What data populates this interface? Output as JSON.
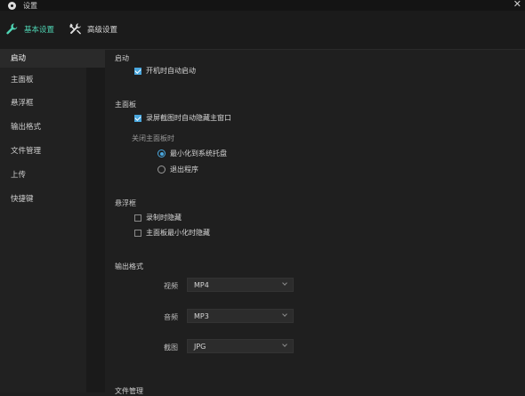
{
  "window": {
    "title": "设置",
    "close_glyph": "✕"
  },
  "tabs": [
    {
      "label": "基本设置",
      "icon": "wrench-icon",
      "active": true
    },
    {
      "label": "高级设置",
      "icon": "tools-icon",
      "active": false
    }
  ],
  "sidebar": {
    "items": [
      {
        "label": "启动",
        "active": true
      },
      {
        "label": "主面板",
        "active": false
      },
      {
        "label": "悬浮框",
        "active": false
      },
      {
        "label": "输出格式",
        "active": false
      },
      {
        "label": "文件管理",
        "active": false
      },
      {
        "label": "上传",
        "active": false
      },
      {
        "label": "快捷键",
        "active": false
      }
    ]
  },
  "sections": {
    "startup": {
      "title": "启动",
      "auto_start": {
        "label": "开机时自动启动",
        "checked": true
      }
    },
    "main_panel": {
      "title": "主面板",
      "hide_on_capture": {
        "label": "录屏截图时自动隐藏主窗口",
        "checked": true
      },
      "close_label": "关闭主面板时",
      "close_options": [
        {
          "label": "最小化到系统托盘",
          "checked": true
        },
        {
          "label": "退出程序",
          "checked": false
        }
      ]
    },
    "floating": {
      "title": "悬浮框",
      "options": [
        {
          "label": "录制时隐藏",
          "checked": false
        },
        {
          "label": "主面板最小化时隐藏",
          "checked": false
        }
      ]
    },
    "output": {
      "title": "输出格式",
      "video": {
        "label": "视频",
        "value": "MP4"
      },
      "audio": {
        "label": "音频",
        "value": "MP3"
      },
      "image": {
        "label": "截图",
        "value": "JPG"
      }
    },
    "file_mgmt": {
      "title": "文件管理"
    }
  },
  "colors": {
    "accent": "#4fd6b5",
    "checkbox": "#4aa7de",
    "bg": "#1f1f1f"
  }
}
